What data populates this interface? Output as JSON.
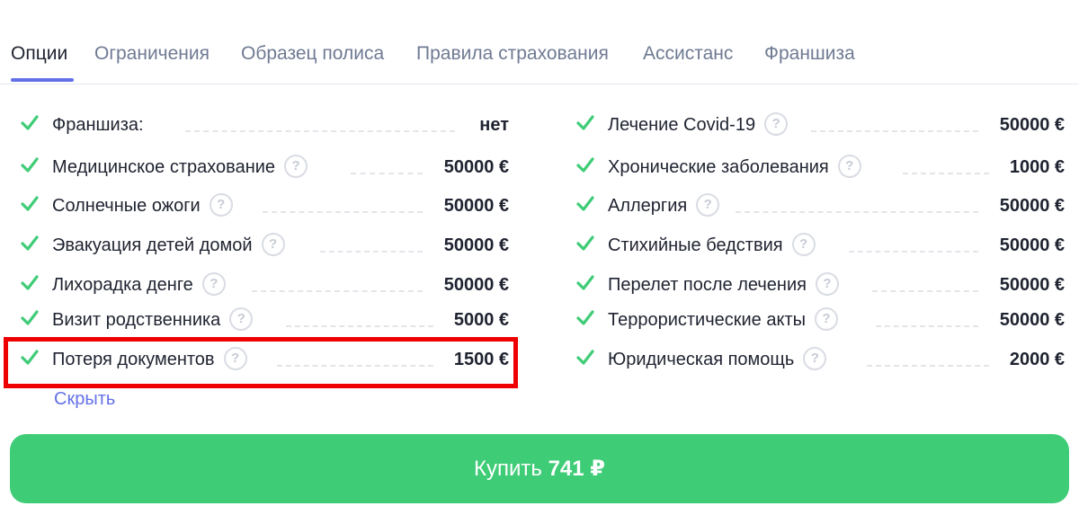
{
  "tabs": [
    {
      "label": "Опции"
    },
    {
      "label": "Ограничения"
    },
    {
      "label": "Образец полиса"
    },
    {
      "label": "Правила страхования"
    },
    {
      "label": "Ассистанс"
    },
    {
      "label": "Франшиза"
    }
  ],
  "left_options": [
    {
      "label": "Франшиза:",
      "value": "нет"
    },
    {
      "label": "Медицинское страхование",
      "value": "50000 €"
    },
    {
      "label": "Солнечные ожоги",
      "value": "50000 €"
    },
    {
      "label": "Эвакуация детей домой",
      "value": "50000 €"
    },
    {
      "label": "Лихорадка денге",
      "value": "50000 €"
    },
    {
      "label": "Визит родственника",
      "value": "5000 €"
    },
    {
      "label": "Потеря документов",
      "value": "1500 €"
    }
  ],
  "right_options": [
    {
      "label": "Лечение Covid-19",
      "value": "50000 €"
    },
    {
      "label": "Хронические заболевания",
      "value": "1000 €"
    },
    {
      "label": "Аллергия",
      "value": "50000 €"
    },
    {
      "label": "Стихийные бедствия",
      "value": "50000 €"
    },
    {
      "label": "Перелет после лечения",
      "value": "50000 €"
    },
    {
      "label": "Террористические акты",
      "value": "50000 €"
    },
    {
      "label": "Юридическая помощь",
      "value": "2000 €"
    }
  ],
  "help_glyph": "?",
  "hide_link": "Скрыть",
  "buy_button": {
    "label": "Купить",
    "price": "741 ₽"
  },
  "colors": {
    "accent": "#6471e6",
    "check": "#3fcc77",
    "button": "#3fcc77",
    "highlight": "#ee0000"
  }
}
